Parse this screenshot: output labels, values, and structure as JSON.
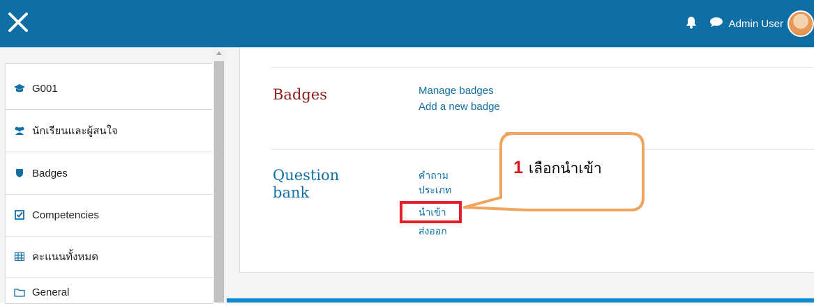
{
  "header": {
    "user_name": "Admin User",
    "bg_color": "#0f6fa5"
  },
  "sidebar": {
    "items": [
      {
        "label": "G001",
        "icon": "graduation-cap-icon"
      },
      {
        "label": "นักเรียนและผู้สนใจ",
        "icon": "users-icon"
      },
      {
        "label": "Badges",
        "icon": "shield-icon"
      },
      {
        "label": "Competencies",
        "icon": "checkbox-icon"
      },
      {
        "label": "คะแนนทั้งหมด",
        "icon": "table-icon"
      },
      {
        "label": "General",
        "icon": "folder-icon"
      }
    ]
  },
  "main": {
    "badges": {
      "title": "Badges",
      "links": [
        "Manage badges",
        "Add a new badge"
      ]
    },
    "question_bank": {
      "title_line1": "Question",
      "title_line2": "bank",
      "links": [
        "คำถาม",
        "ประเภท",
        "นำเข้า",
        "ส่งออก"
      ]
    }
  },
  "callout": {
    "number": "1",
    "text": "เลือกนำเข้า",
    "border_color": "#f0a35a"
  },
  "highlight_color": "#e61e2a"
}
